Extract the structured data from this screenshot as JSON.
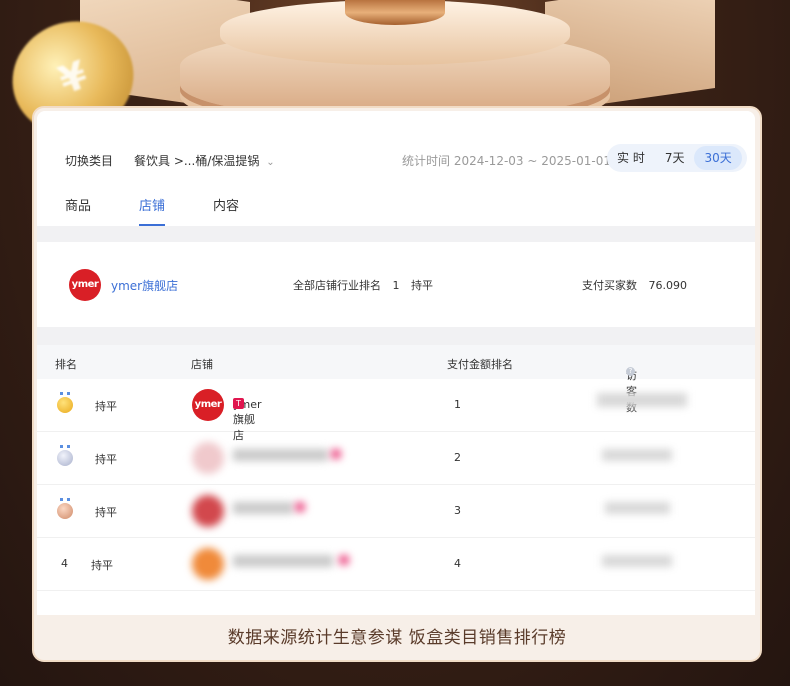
{
  "header": {
    "switch_label": "切换类目",
    "category_path": "餐饮具 >...桶/保温提锅",
    "date_range": "统计时间 2024-12-03 ~ 2025-01-01",
    "periods": [
      "实 时",
      "7天",
      "30天"
    ],
    "active_period": "30天"
  },
  "tabs": [
    "商品",
    "店铺",
    "内容"
  ],
  "active_tab": "店铺",
  "shop_summary": {
    "logo_text": "ymer",
    "name": "ymer旗舰店",
    "rank_label": "全部店铺行业排名",
    "rank_value": "1",
    "rank_change": "持平",
    "buyers_label": "支付买家数",
    "buyers_value": "76.090"
  },
  "table": {
    "headers": {
      "rank": "排名",
      "shop": "店铺",
      "pay_rank": "支付金额排名",
      "visitors": "访客数"
    },
    "rows": [
      {
        "rank": "1",
        "change": "持平",
        "shop": "ymer旗舰店",
        "pay_rank": "1"
      },
      {
        "rank": "2",
        "change": "持平",
        "shop": "",
        "pay_rank": "2"
      },
      {
        "rank": "3",
        "change": "持平",
        "shop": "",
        "pay_rank": "3"
      },
      {
        "rank": "4",
        "change": "持平",
        "shop": "",
        "pay_rank": "4"
      }
    ]
  },
  "footer": "数据来源统计生意参谋 饭盒类目销售排行榜",
  "colors": {
    "accent": "#3b6fd6",
    "brand_red": "#d91f26",
    "background_dark": "#3b2216"
  }
}
